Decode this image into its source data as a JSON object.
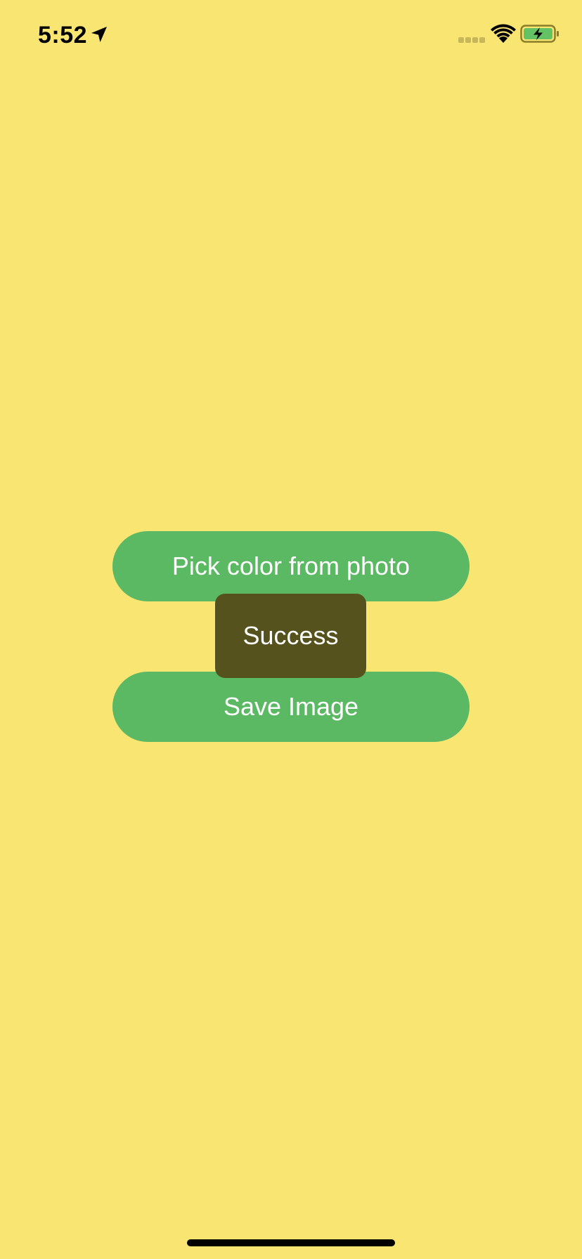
{
  "status_bar": {
    "time": "5:52",
    "location_icon": "location-arrow-icon",
    "signal_icon": "cellular-signal-icon",
    "wifi_icon": "wifi-icon",
    "battery_icon": "battery-charging-icon"
  },
  "main": {
    "pick_color_label": "Pick color from photo",
    "save_image_label": "Save Image",
    "toast_message": "Success"
  },
  "colors": {
    "background": "#F9E571",
    "button": "#5BB963",
    "toast": "#55521E",
    "battery_fill": "#63C364"
  }
}
